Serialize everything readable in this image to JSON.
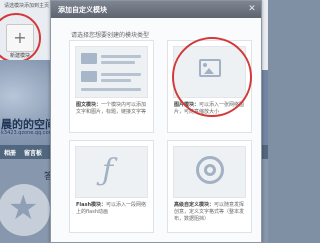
{
  "background": {
    "top_text": "请选模块添加到主页",
    "add_module_label": "新建模块",
    "add_icon": "plus-icon",
    "space_name": "晨的的空间",
    "space_url": "k3423.qzone.qq.com",
    "nav": [
      "相册",
      "留言板",
      "说说"
    ],
    "answer_text": "答疑"
  },
  "dialog": {
    "title": "添加自定义模块",
    "close_icon": "close-icon",
    "subtitle": "请选择您想要创建的模块类型",
    "modules": [
      {
        "name": "图文模块：",
        "desc": "一个模块内可以添加文字和图片，标题，链接文字等",
        "icon": "text-image-module-icon"
      },
      {
        "name": "图片模块：",
        "desc": "可以添入一张网络图片，可随意缩放大小",
        "icon": "image-module-icon"
      },
      {
        "name": "Flash模块：",
        "desc": "可以添入一段网络上的flash动画",
        "icon": "flash-icon"
      },
      {
        "name": "高级自定义模块：",
        "desc": "可以随意发挥创意，定义文字格式等（整本发布，数据阻挡）",
        "icon": "advanced-module-icon"
      }
    ]
  },
  "colors": {
    "dialog_header": "#6b717d",
    "highlight_circle": "#d23a3a",
    "page_background": "#7f8fa4"
  }
}
